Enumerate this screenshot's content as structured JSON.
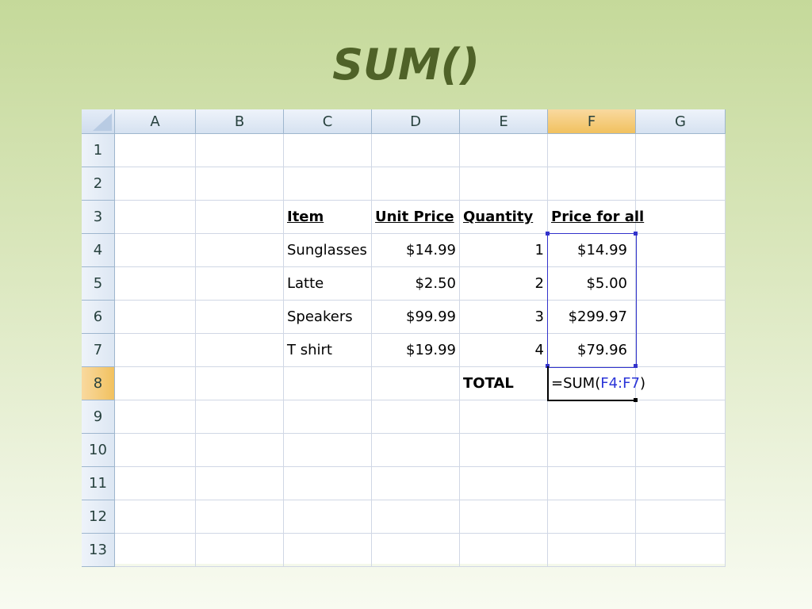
{
  "title": "SUM()",
  "sheet": {
    "corner_label": "select-all",
    "columns": [
      "A",
      "B",
      "C",
      "D",
      "E",
      "F",
      "G"
    ],
    "active_column": "F",
    "rows": [
      "1",
      "2",
      "3",
      "4",
      "5",
      "6",
      "7",
      "8",
      "9",
      "10",
      "11",
      "12",
      "13"
    ],
    "active_row": "8",
    "headers": {
      "item": "Item",
      "unit_price": "Unit Price",
      "quantity": "Quantity",
      "price_for_all": "Price for all"
    },
    "items": [
      {
        "item": "Sunglasses",
        "unit_price": "$14.99",
        "quantity": "1",
        "price_for_all": "$14.99"
      },
      {
        "item": "Latte",
        "unit_price": "$2.50",
        "quantity": "2",
        "price_for_all": "$5.00"
      },
      {
        "item": "Speakers",
        "unit_price": "$99.99",
        "quantity": "3",
        "price_for_all": "$299.97"
      },
      {
        "item": "T shirt",
        "unit_price": "$19.99",
        "quantity": "4",
        "price_for_all": "$79.96"
      }
    ],
    "total_label": "TOTAL",
    "formula": {
      "prefix": "=SUM(",
      "range": "F4:F7",
      "suffix": ")"
    },
    "colors": {
      "title": "#4f6228",
      "range_highlight": "#3333cc",
      "active_header": "#f1c15f"
    }
  }
}
